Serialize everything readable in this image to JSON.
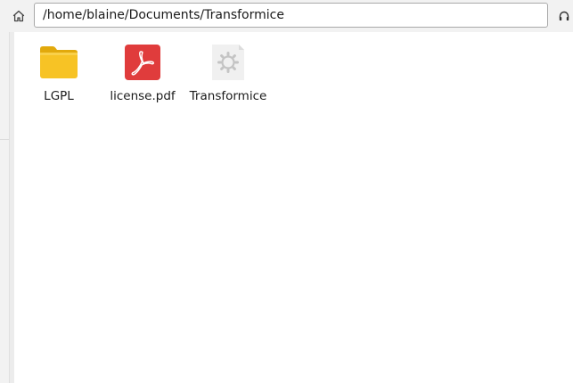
{
  "toolbar": {
    "home_icon": "home-icon",
    "location": "/home/blaine/Documents/Transformice",
    "right_icon": "headphones-icon"
  },
  "files": [
    {
      "label": "LGPL",
      "icon": "folder-icon",
      "color": "#f7c325"
    },
    {
      "label": "license.pdf",
      "icon": "pdf-icon",
      "color": "#e03c3c"
    },
    {
      "label": "Transformice",
      "icon": "executable-gear-icon",
      "color": "#f2f2f2"
    }
  ]
}
